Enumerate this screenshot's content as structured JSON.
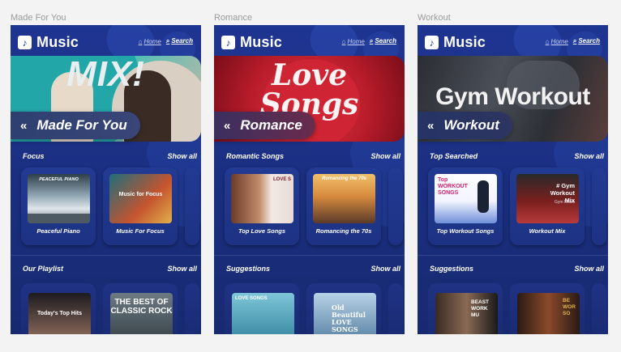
{
  "app": {
    "logo_icon": "music-note-icon",
    "logo_text": "Music",
    "nav_home": "Home",
    "nav_search": "Search"
  },
  "screens": [
    {
      "frame_label": "Made For You",
      "hero_banner_text": "MIX!",
      "hero_title": "Made For You",
      "section1": {
        "title": "Focus",
        "show_all": "Show all",
        "cards": [
          {
            "title": "Peaceful Piano",
            "art_text": "PEACEFUL PIANO"
          },
          {
            "title": "Music For Focus",
            "art_text": "Music for Focus"
          }
        ]
      },
      "section2": {
        "title": "Our Playlist",
        "show_all": "Show all",
        "cards": [
          {
            "art_text": "Today's Top Hits"
          },
          {
            "art_text": "THE BEST OF CLASSIC ROCK"
          }
        ]
      }
    },
    {
      "frame_label": "Romance",
      "hero_banner_text": "Love Songs",
      "hero_title": "Romance",
      "section1": {
        "title": "Romantic Songs",
        "show_all": "Show all",
        "cards": [
          {
            "title": "Top Love Songs",
            "art_text": "LOVE S"
          },
          {
            "title": "Romancing the 70s",
            "art_text": "Romancing the 70s"
          }
        ]
      },
      "section2": {
        "title": "Suggestions",
        "show_all": "Show all",
        "cards": [
          {
            "art_text": "LOVE SONGS"
          },
          {
            "art_text": "Old Beautiful LOVE SONGS"
          }
        ]
      }
    },
    {
      "frame_label": "Workout",
      "hero_banner_text": "Gym Workout",
      "hero_title": "Workout",
      "section1": {
        "title": "Top Searched",
        "show_all": "Show all",
        "cards": [
          {
            "title": "Top Workout Songs",
            "art_text": "Top WORKOUT SONGS"
          },
          {
            "title": "Workout Mix",
            "art_text": "# Gym Workout Mix",
            "art_sub": "Gym Music"
          }
        ]
      },
      "section2": {
        "title": "Suggestions",
        "show_all": "Show all",
        "cards": [
          {
            "art_text": "BEAST WORK MU"
          },
          {
            "art_text": "BE WOR SO"
          }
        ]
      }
    }
  ]
}
